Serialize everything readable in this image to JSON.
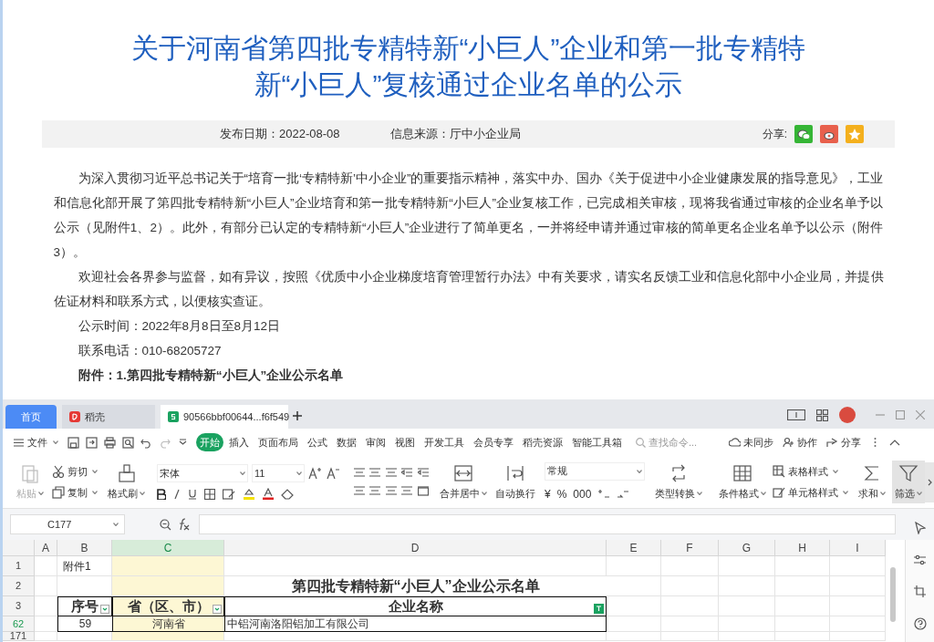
{
  "article": {
    "title": "关于河南省第四批专精特新“小巨人”企业和第一批专精特新“小巨人”复核通过企业名单的公示",
    "meta": {
      "date": "发布日期：2022-08-08",
      "source": "信息来源：厅中小企业局",
      "share_label": "分享:"
    },
    "paragraphs": [
      {
        "kind": "body",
        "text": "为深入贯彻习近平总书记关于“培育一批‘专精特新’中小企业”的重要指示精神，落实中办、国办《关于促进中小企业健康发展的指导意见》，工业和信息化部开展了第四批专精特新“小巨人”企业培育和第一批专精特新“小巨人”企业复核工作，已完成相关审核，现将我省通过审核的企业名单予以公示（见附件1、2）。此外，有部分已认定的专精特新“小巨人”企业进行了简单更名，一并将经申请并通过审核的简单更名企业名单予以公示（附件3）。"
      },
      {
        "kind": "body",
        "text": "欢迎社会各界参与监督，如有异议，按照《优质中小企业梯度培育管理暂行办法》中有关要求，请实名反馈工业和信息化部中小企业局，并提供佐证材料和联系方式，以便核实查证。"
      },
      {
        "kind": "body",
        "text": "公示时间：2022年8月8日至8月12日"
      },
      {
        "kind": "body",
        "text": "联系电话：010-68205727"
      },
      {
        "kind": "bold",
        "text": "附件：1.第四批专精特新“小巨人”企业公示名单"
      }
    ]
  },
  "spreadsheet": {
    "tabs": [
      {
        "label": "首页",
        "kind": "home",
        "selected": false
      },
      {
        "label": "稻壳",
        "kind": "docer",
        "selected": false
      },
      {
        "label": "90566bbf00644...f6f549",
        "kind": "sheet",
        "selected": true
      }
    ],
    "menu": {
      "file": "文件",
      "tabs": [
        {
          "label": "开始",
          "selected": true
        },
        {
          "label": "插入",
          "selected": false
        },
        {
          "label": "页面布局",
          "selected": false
        },
        {
          "label": "公式",
          "selected": false
        },
        {
          "label": "数据",
          "selected": false
        },
        {
          "label": "审阅",
          "selected": false
        },
        {
          "label": "视图",
          "selected": false
        },
        {
          "label": "开发工具",
          "selected": false
        },
        {
          "label": "会员专享",
          "selected": false
        },
        {
          "label": "稻壳资源",
          "selected": false
        },
        {
          "label": "智能工具箱",
          "selected": false
        }
      ],
      "search_placeholder": "查找命令...",
      "sync": "未同步",
      "collab": "协作",
      "share": "分享"
    },
    "ribbon": {
      "paste": {
        "label": "粘贴",
        "disabled": true
      },
      "cut": "剪切",
      "copy": "复制",
      "format_painter": "格式刷",
      "font_name": "宋体",
      "font_size": "11",
      "merge": "合并居中",
      "wrap": "自动换行",
      "number_format": "常规",
      "number_symbols": [
        "¥",
        "%",
        "000"
      ],
      "convert": "类型转换",
      "conditional": "条件格式",
      "table_style": "表格样式",
      "cell_style": "单元格样式",
      "sum": "求和",
      "filter": "筛选"
    },
    "name_box": "C177",
    "columns": [
      {
        "label": "A",
        "selected": false
      },
      {
        "label": "B",
        "selected": false
      },
      {
        "label": "C",
        "selected": true
      },
      {
        "label": "D",
        "selected": false
      },
      {
        "label": "E",
        "selected": false
      },
      {
        "label": "F",
        "selected": false
      },
      {
        "label": "G",
        "selected": false
      },
      {
        "label": "H",
        "selected": false
      },
      {
        "label": "I",
        "selected": false
      }
    ],
    "rows": [
      {
        "header": "1",
        "filtered": false,
        "kind": "plain",
        "cells": [
          {
            "text": ""
          },
          {
            "text": "附件1"
          },
          {
            "text": ""
          },
          {
            "text": ""
          },
          {
            "text": ""
          },
          {
            "text": ""
          },
          {
            "text": ""
          },
          {
            "text": ""
          },
          {
            "text": ""
          }
        ]
      },
      {
        "header": "2",
        "filtered": false,
        "kind": "title",
        "cells": [
          {
            "text": ""
          },
          {
            "text": ""
          },
          {
            "text": ""
          },
          {
            "text": "第四批专精特新“小巨人”企业公示名单"
          },
          {
            "text": ""
          },
          {
            "text": ""
          },
          {
            "text": ""
          },
          {
            "text": ""
          },
          {
            "text": ""
          }
        ]
      },
      {
        "header": "3",
        "filtered": false,
        "kind": "header",
        "cells": [
          {
            "text": ""
          },
          {
            "text": "序号",
            "filter_active": false
          },
          {
            "text": "省（区、市）",
            "filter_active": false
          },
          {
            "text": "企业名称",
            "filter_active": true
          },
          {
            "text": ""
          },
          {
            "text": ""
          },
          {
            "text": ""
          },
          {
            "text": ""
          },
          {
            "text": ""
          }
        ]
      },
      {
        "header": "62",
        "filtered": true,
        "kind": "data",
        "cells": [
          {
            "text": ""
          },
          {
            "text": "59"
          },
          {
            "text": "河南省"
          },
          {
            "text": "中铝河南洛阳铝加工有限公司"
          },
          {
            "text": ""
          },
          {
            "text": ""
          },
          {
            "text": ""
          },
          {
            "text": ""
          },
          {
            "text": ""
          }
        ]
      },
      {
        "header": "171",
        "filtered": false,
        "kind": "plain",
        "cells": [
          {
            "text": ""
          },
          {
            "text": ""
          },
          {
            "text": ""
          },
          {
            "text": ""
          },
          {
            "text": ""
          },
          {
            "text": ""
          },
          {
            "text": ""
          },
          {
            "text": ""
          },
          {
            "text": ""
          }
        ]
      }
    ]
  }
}
